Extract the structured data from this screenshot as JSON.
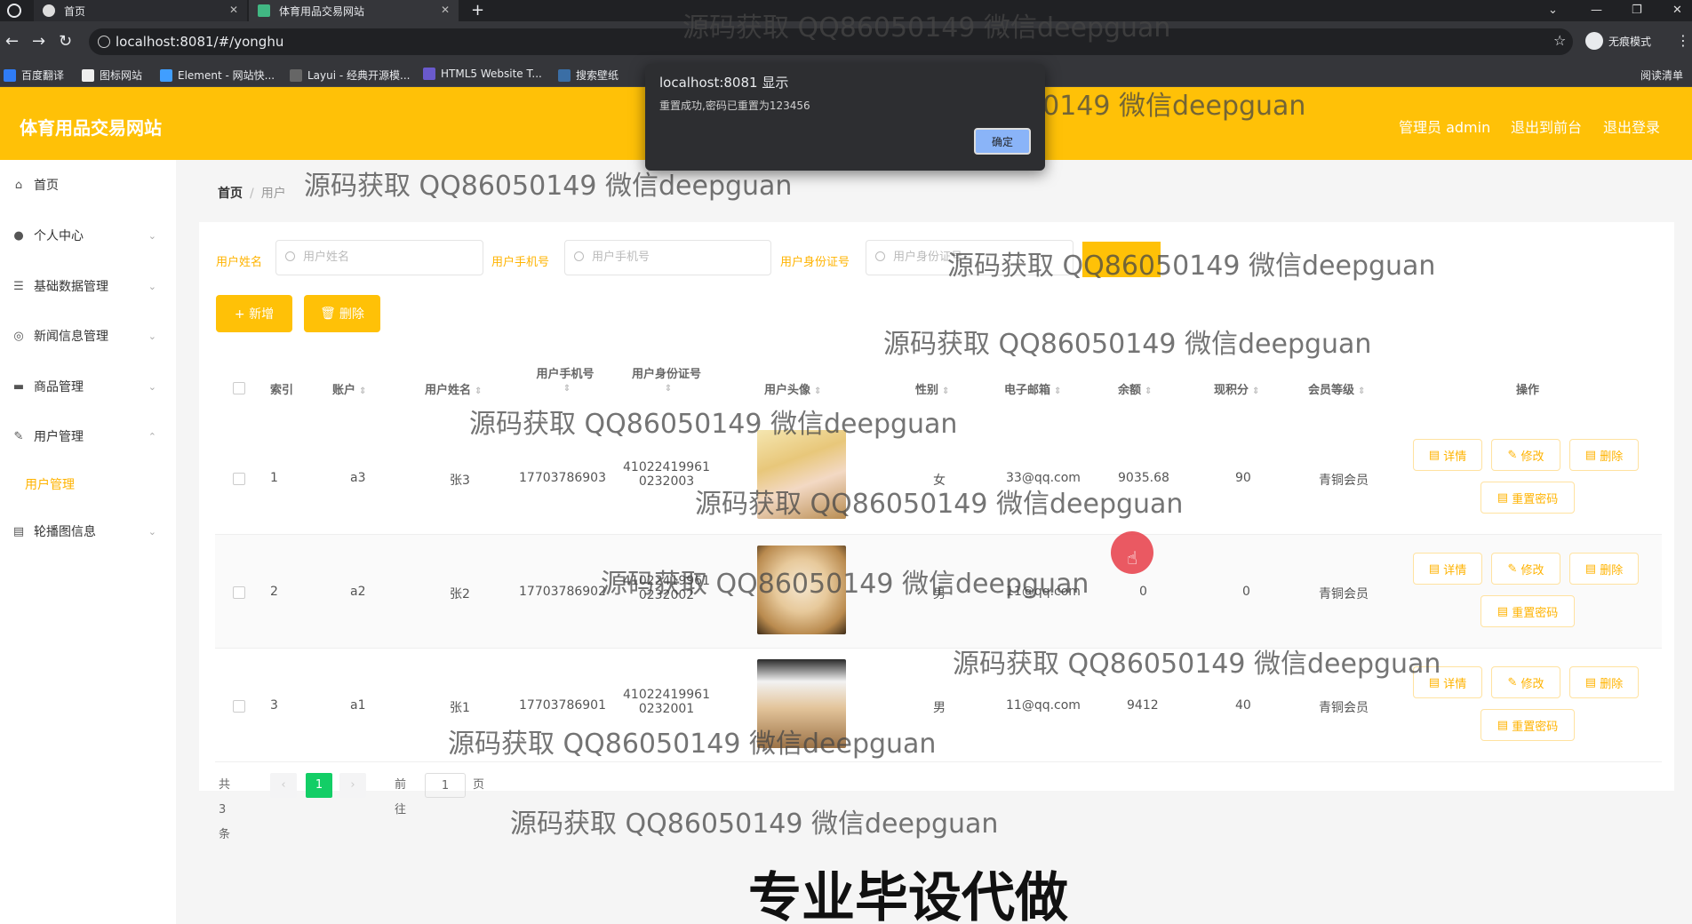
{
  "browser": {
    "tabs": [
      {
        "label": "首页"
      },
      {
        "label": "体育用品交易网站"
      }
    ],
    "new_tab": "+",
    "url": "localhost:8081/#/yonghu",
    "incognito": "无痕模式",
    "bookmarks": [
      "百度翻译",
      "图标网站",
      "Element - 网站快...",
      "Layui - 经典开源模...",
      "HTML5 Website T...",
      "搜索壁纸"
    ],
    "reading_list": "阅读清单"
  },
  "dialog": {
    "title": "localhost:8081 显示",
    "message": "重置成功,密码已重置为123456",
    "ok": "确定"
  },
  "header": {
    "title": "体育用品交易网站",
    "admin": "管理员 admin",
    "back_front": "退出到前台",
    "logout": "退出登录"
  },
  "sidebar": {
    "items": [
      {
        "label": "首页",
        "icon": "home-icon"
      },
      {
        "label": "个人中心",
        "icon": "user-icon"
      },
      {
        "label": "基础数据管理",
        "icon": "sliders-icon"
      },
      {
        "label": "新闻信息管理",
        "icon": "compass-icon"
      },
      {
        "label": "商品管理",
        "icon": "briefcase-icon"
      },
      {
        "label": "用户管理",
        "icon": "edit-icon"
      },
      {
        "label": "轮播图信息",
        "icon": "list-icon"
      }
    ],
    "sub_item": "用户管理"
  },
  "breadcrumb": {
    "home": "首页",
    "sep": "/",
    "current": "用户"
  },
  "search": {
    "name_label": "用户姓名",
    "name_placeholder": "用户姓名",
    "phone_label": "用户手机号",
    "phone_placeholder": "用户手机号",
    "id_label": "用户身份证号",
    "id_placeholder": "用户身份证号"
  },
  "actions": {
    "add": "+ 新增",
    "delete": "删除"
  },
  "table": {
    "headers": {
      "index": "索引",
      "account": "账户",
      "name": "用户姓名",
      "phone": "用户手机号",
      "idcard": "用户身份证号",
      "avatar": "用户头像",
      "gender": "性别",
      "email": "电子邮箱",
      "balance": "余额",
      "points": "现积分",
      "level": "会员等级",
      "ops": "操作"
    },
    "rows": [
      {
        "index": "1",
        "account": "a3",
        "name": "张3",
        "phone": "17703786903",
        "idcard1": "41022419961",
        "idcard2": "0232003",
        "gender": "女",
        "email": "33@qq.com",
        "balance": "9035.68",
        "points": "90",
        "level": "青铜会员"
      },
      {
        "index": "2",
        "account": "a2",
        "name": "张2",
        "phone": "17703786902",
        "idcard1": "41022419961",
        "idcard2": "0232002",
        "gender": "男",
        "email": "11@qq.com",
        "balance": "0",
        "points": "0",
        "level": "青铜会员"
      },
      {
        "index": "3",
        "account": "a1",
        "name": "张1",
        "phone": "17703786901",
        "idcard1": "41022419961",
        "idcard2": "0232001",
        "gender": "男",
        "email": "11@qq.com",
        "balance": "9412",
        "points": "40",
        "level": "青铜会员"
      }
    ],
    "ops": {
      "detail": "详情",
      "edit": "修改",
      "delete": "删除",
      "reset": "重置密码"
    }
  },
  "pagination": {
    "total": "共 3 条",
    "prev": "‹",
    "page": "1",
    "next": "›",
    "goto": "前往",
    "goto_value": "1",
    "unit": "页"
  },
  "watermark": "源码获取 QQ86050149 微信deepguan",
  "bottom_banner": "专业毕设代做"
}
